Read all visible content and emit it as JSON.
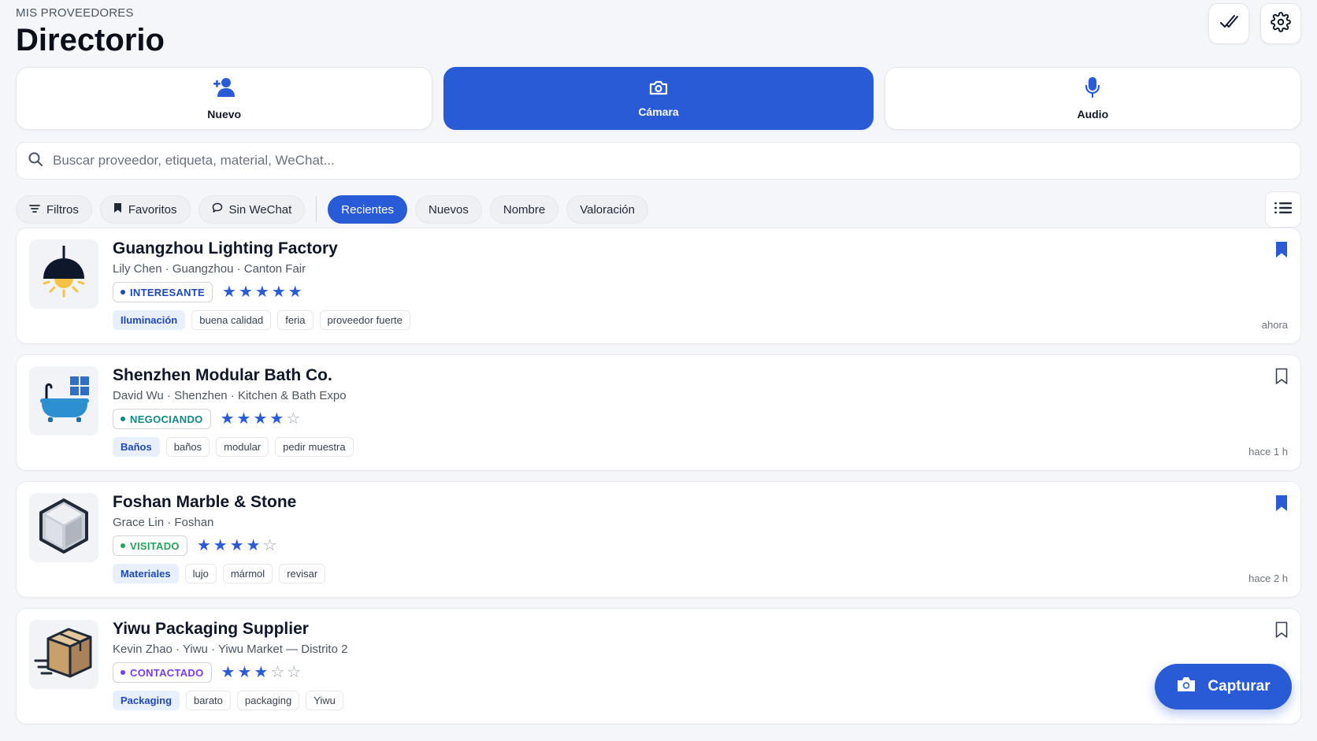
{
  "header": {
    "eyebrow": "MIS PROVEEDORES",
    "title": "Directorio"
  },
  "top_actions": [
    {
      "icon": "double-check-icon"
    },
    {
      "icon": "gear-icon"
    }
  ],
  "capture_modes": [
    {
      "label": "Nuevo",
      "icon": "add-person-icon",
      "active": false
    },
    {
      "label": "Cámara",
      "icon": "camera-icon",
      "active": true
    },
    {
      "label": "Audio",
      "icon": "microphone-icon",
      "active": false
    }
  ],
  "search": {
    "placeholder": "Buscar proveedor, etiqueta, material, WeChat...",
    "value": ""
  },
  "filters": {
    "filters_label": "Filtros",
    "favorites_label": "Favoritos",
    "no_wechat_label": "Sin WeChat",
    "sort_options": [
      "Recientes",
      "Nuevos",
      "Nombre",
      "Valoración"
    ],
    "active_sort": "Recientes"
  },
  "colors": {
    "accent": "#2a5bd7",
    "status_interesante": "#1e49b8",
    "status_negociando": "#0f8a8a",
    "status_visitado": "#22a559",
    "status_contactado": "#7c3aed"
  },
  "suppliers": [
    {
      "name": "Guangzhou Lighting Factory",
      "meta": "Lily Chen · Guangzhou · Canton Fair",
      "status": "INTERESANTE",
      "rating": 5,
      "category": "Iluminación",
      "tags": [
        "buena calidad",
        "feria",
        "proveedor fuerte"
      ],
      "time": "ahora",
      "bookmarked": true,
      "thumb_icon": "ceiling-lamp-icon"
    },
    {
      "name": "Shenzhen Modular Bath Co.",
      "meta": "David Wu · Shenzhen · Kitchen & Bath Expo",
      "status": "NEGOCIANDO",
      "rating": 4,
      "category": "Baños",
      "tags": [
        "baños",
        "modular",
        "pedir muestra"
      ],
      "time": "hace 1 h",
      "bookmarked": false,
      "thumb_icon": "bathtub-icon"
    },
    {
      "name": "Foshan Marble & Stone",
      "meta": "Grace Lin · Foshan",
      "status": "VISITADO",
      "rating": 4,
      "category": "Materiales",
      "tags": [
        "lujo",
        "mármol",
        "revisar"
      ],
      "time": "hace 2 h",
      "bookmarked": true,
      "thumb_icon": "stone-block-icon"
    },
    {
      "name": "Yiwu Packaging Supplier",
      "meta": "Kevin Zhao · Yiwu · Yiwu Market — Distrito 2",
      "status": "CONTACTADO",
      "rating": 3,
      "category": "Packaging",
      "tags": [
        "barato",
        "packaging",
        "Yiwu"
      ],
      "time": "",
      "bookmarked": false,
      "thumb_icon": "shipping-box-icon"
    }
  ],
  "fab": {
    "label": "Capturar",
    "icon": "camera-icon"
  }
}
